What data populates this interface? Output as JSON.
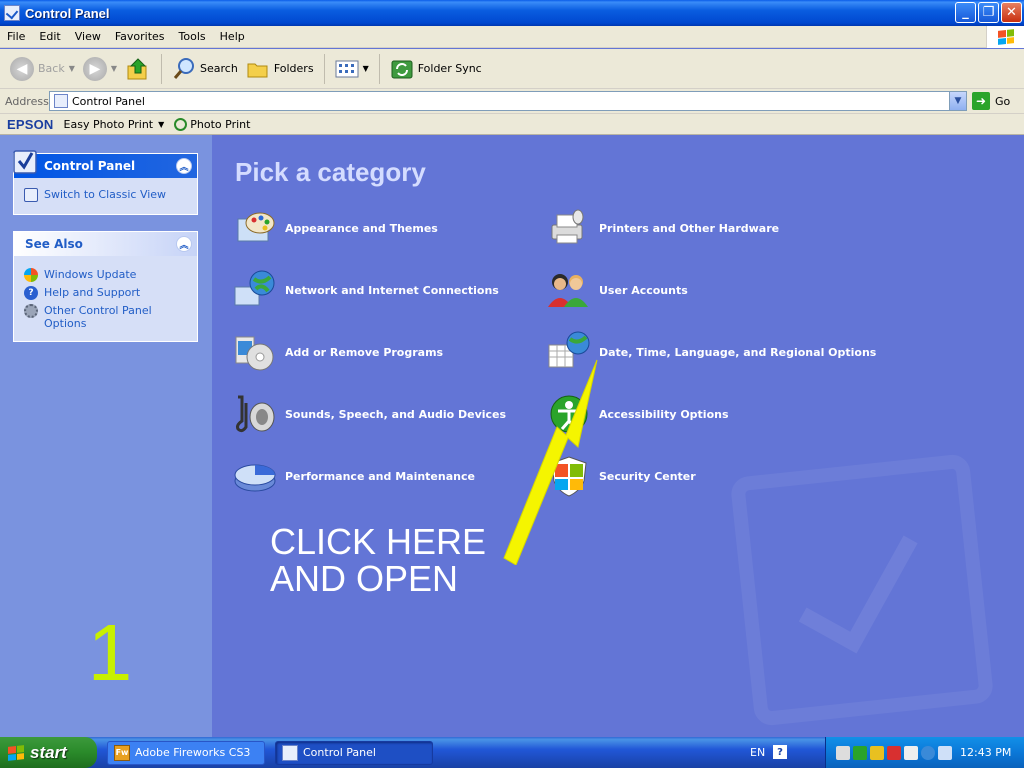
{
  "window": {
    "title": "Control Panel"
  },
  "menu": [
    "File",
    "Edit",
    "View",
    "Favorites",
    "Tools",
    "Help"
  ],
  "toolbar": {
    "back": "Back",
    "search": "Search",
    "folders": "Folders",
    "folder_sync": "Folder Sync"
  },
  "address": {
    "label": "Address",
    "value": "Control Panel",
    "go": "Go"
  },
  "epson_bar": {
    "brand": "EPSON",
    "easy_photo_print": "Easy Photo Print",
    "photo_print": "Photo Print"
  },
  "left_pane": {
    "control_panel": {
      "title": "Control Panel",
      "items": [
        "Switch to Classic View"
      ]
    },
    "see_also": {
      "title": "See Also",
      "items": [
        "Windows Update",
        "Help and Support",
        "Other Control Panel Options"
      ]
    },
    "step_number": "1"
  },
  "main": {
    "heading": "Pick a category",
    "categories": [
      "Appearance and Themes",
      "Printers and Other Hardware",
      "Network and Internet Connections",
      "User Accounts",
      "Add or Remove Programs",
      "Date, Time, Language, and Regional Options",
      "Sounds, Speech, and Audio Devices",
      "Accessibility Options",
      "Performance and Maintenance",
      "Security Center"
    ],
    "annotation_line1": "CLICK HERE",
    "annotation_line2": "AND OPEN",
    "arrow_color": "#f5f500"
  },
  "taskbar": {
    "start": "start",
    "tasks": [
      "Adobe Fireworks CS3",
      "Control Panel"
    ],
    "language": "EN",
    "clock": "12:43 PM"
  }
}
